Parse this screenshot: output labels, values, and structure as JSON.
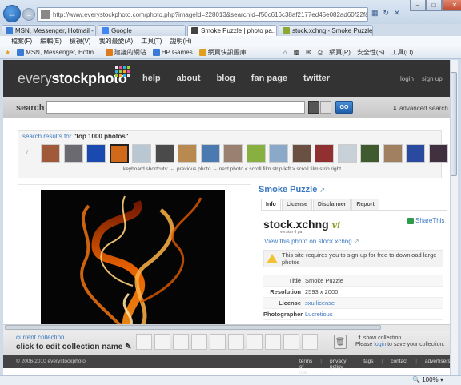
{
  "browser": {
    "url": "http://www.everystockphoto.com/photo.php?imageId=228013&searchId=f50c616c38af2177ed45e082ad60f22f&npos=4",
    "tabs": [
      {
        "label": "MSN, Messenger, Hotmail - ..."
      },
      {
        "label": "Google"
      },
      {
        "label": "Smoke Puzzle | photo pa..."
      },
      {
        "label": "stock.xchng - Smoke Puzzle (..."
      }
    ],
    "menu": [
      "檔案(F)",
      "編輯(E)",
      "檢視(V)",
      "我的最愛(A)",
      "工具(T)",
      "說明(H)"
    ],
    "favorites": [
      {
        "label": "MSN, Messenger, Hotm...",
        "color": "#3a7bd5"
      },
      {
        "label": "建議的網站",
        "color": "#e07a1e"
      },
      {
        "label": "HP Games",
        "color": "#3a7bd5"
      },
      {
        "label": "網頁快訊圖庫",
        "color": "#e0a01e"
      }
    ],
    "commands": [
      "網頁(P)",
      "安全性(S)",
      "工具(O)"
    ],
    "zoom": "100%"
  },
  "site": {
    "logo_part1": "every",
    "logo_part2": "stockphoto",
    "logo_colors": [
      "#e8e8e8",
      "#f04e9a",
      "#2fb0e8",
      "#9bcf3c",
      "#2fb0e8",
      "#9bcf3c",
      "#f5a623",
      "#f04e9a",
      "#9bcf3c",
      "#f5a623",
      "#2fb0e8",
      "#e8e8e8"
    ],
    "nav": [
      "help",
      "about",
      "blog",
      "fan page",
      "twitter"
    ],
    "user_nav": [
      "login",
      "sign up"
    ],
    "search": {
      "label": "search",
      "value": "",
      "go": "GO",
      "advanced": "advanced search"
    },
    "results_prefix": "search results for",
    "results_query": "\"top 1000 photos\"",
    "shortcuts": "keyboard shortcuts: ← previous photo → next photo < scroll film strip left > scroll film strip right",
    "thumbnails": [
      {
        "color": "#a05a3a"
      },
      {
        "color": "#6a6a70"
      },
      {
        "color": "#1a4ab0"
      },
      {
        "color": "#d06a1a"
      },
      {
        "color": "#b9c7d3"
      },
      {
        "color": "#4a4a4a"
      },
      {
        "color": "#b88a50"
      },
      {
        "color": "#4a7ab0"
      },
      {
        "color": "#9a8070"
      },
      {
        "color": "#88b040"
      },
      {
        "color": "#8aa8c8"
      },
      {
        "color": "#6a5040"
      },
      {
        "color": "#903030"
      },
      {
        "color": "#c8d0d8"
      },
      {
        "color": "#405a30"
      },
      {
        "color": "#a08060"
      },
      {
        "color": "#2a4aa0"
      },
      {
        "color": "#403040"
      }
    ],
    "photo": {
      "title": "Smoke Puzzle",
      "tabs": [
        "Info",
        "License",
        "Disclaimer",
        "Report"
      ],
      "source_logo": "stock.xchng",
      "source_logo_suffix": "vi",
      "source_version": "version 6 pa",
      "share": "ShareThis",
      "view_on": "View this photo on stock.xchng",
      "notice": "This site requires you to sign-up for free to download large photos",
      "meta": [
        {
          "label": "Title",
          "value": "Smoke Puzzle",
          "link": false
        },
        {
          "label": "Resolution",
          "value": "2593 x 2000",
          "link": false
        },
        {
          "label": "License",
          "value": "sxu license",
          "link": true
        },
        {
          "label": "Photographer",
          "value": "Lucretious",
          "link": true
        }
      ]
    },
    "collection": {
      "current": "current collection",
      "edit": "click to edit collection name",
      "show": "show collection",
      "save_prefix": "Please",
      "save_link": "login",
      "save_suffix": "to save your collection."
    },
    "footer": {
      "copyright": "© 2006-2010 everystockphoto",
      "links": [
        "terms of use",
        "privacy policy",
        "tags",
        "contact",
        "advertisers"
      ]
    }
  }
}
